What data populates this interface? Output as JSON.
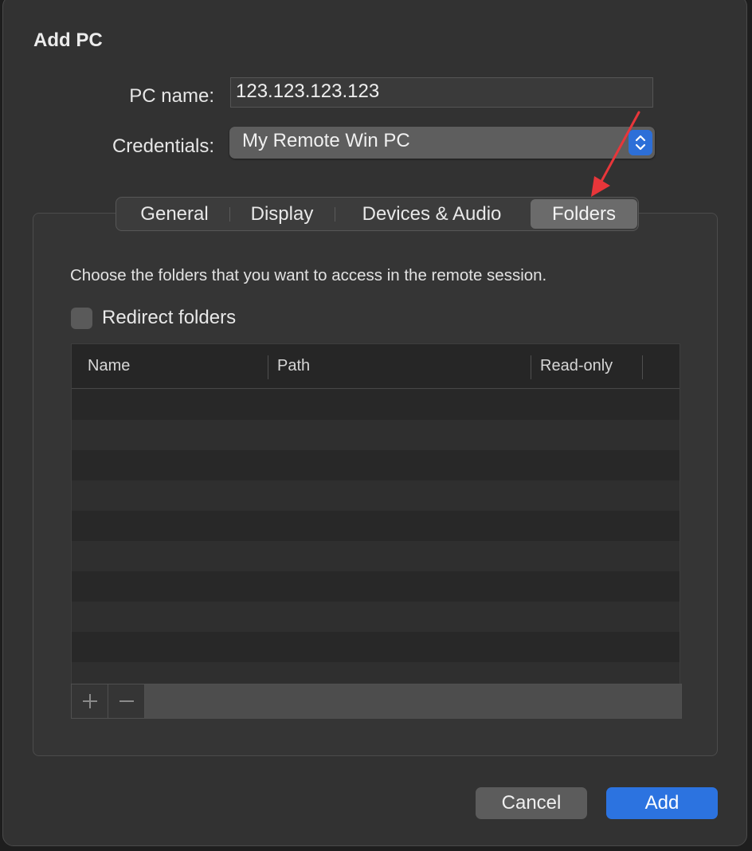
{
  "dialog": {
    "title": "Add PC"
  },
  "form": {
    "pc_name_label": "PC name:",
    "pc_name_value": "123.123.123.123",
    "credentials_label": "Credentials:",
    "credentials_value": "My Remote Win PC"
  },
  "tabs": [
    {
      "label": "General",
      "selected": false
    },
    {
      "label": "Display",
      "selected": false
    },
    {
      "label": "Devices & Audio",
      "selected": false
    },
    {
      "label": "Folders",
      "selected": true
    }
  ],
  "folders": {
    "description": "Choose the folders that you want to access in the remote session.",
    "redirect_label": "Redirect folders",
    "redirect_checked": false,
    "columns": [
      "Name",
      "Path",
      "Read-only"
    ],
    "rows": []
  },
  "buttons": {
    "cancel": "Cancel",
    "add": "Add",
    "add_folder_icon": "plus-icon",
    "remove_folder_icon": "minus-icon"
  },
  "colors": {
    "accent": "#2c73e0",
    "annotation_arrow": "#e8363a"
  }
}
